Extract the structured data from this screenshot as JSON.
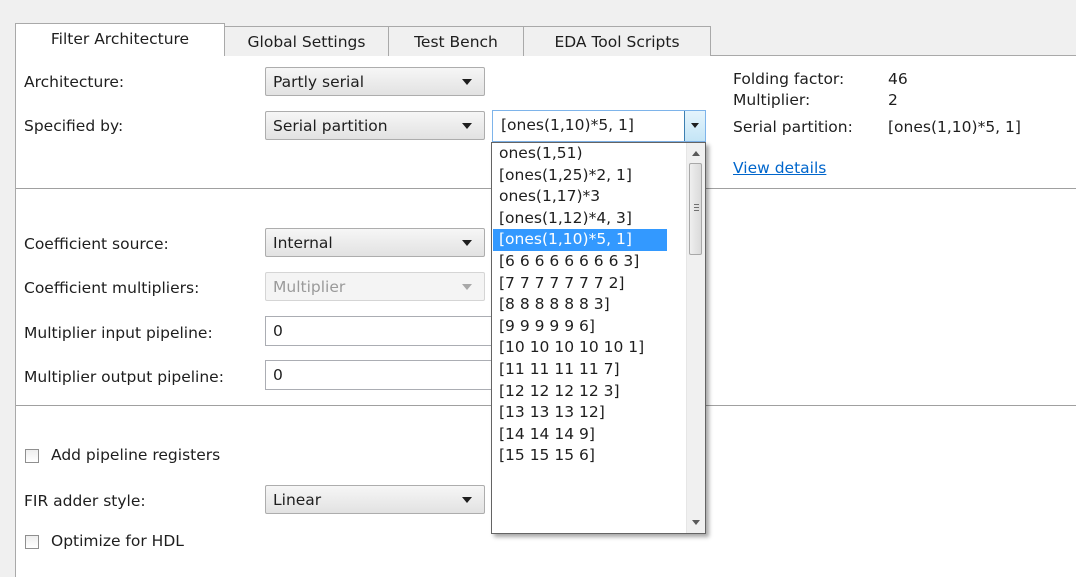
{
  "tabs": [
    {
      "label": "Filter Architecture",
      "active": true
    },
    {
      "label": "Global Settings",
      "active": false
    },
    {
      "label": "Test Bench",
      "active": false
    },
    {
      "label": "EDA Tool Scripts",
      "active": false
    }
  ],
  "architecture": {
    "label": "Architecture:",
    "value": "Partly serial"
  },
  "specified_by": {
    "label": "Specified by:",
    "value": "Serial partition"
  },
  "partition_combo": {
    "value": "[ones(1,10)*5, 1]",
    "options": [
      "ones(1,51)",
      "[ones(1,25)*2, 1]",
      "ones(1,17)*3",
      "[ones(1,12)*4, 3]",
      "[ones(1,10)*5, 1]",
      "[6 6 6 6 6 6 6 6 3]",
      "[7 7 7 7 7 7 7 2]",
      "[8 8 8 8 8 8 3]",
      "[9 9 9 9 9 6]",
      "[10 10 10 10 10 1]",
      "[11 11 11 11 7]",
      "[12 12 12 12 3]",
      "[13 13 13 12]",
      "[14 14 14 9]",
      "[15 15 15 6]"
    ],
    "selected_option": "[ones(1,10)*5, 1]"
  },
  "info": {
    "folding_label": "Folding factor:",
    "folding_value": "46",
    "multiplier_label": "Multiplier:",
    "multiplier_value": "2",
    "partition_label": "Serial partition:",
    "partition_value": "[ones(1,10)*5, 1]",
    "view_details": "View details"
  },
  "coefficient_source": {
    "label": "Coefficient source:",
    "value": "Internal"
  },
  "coefficient_multipliers": {
    "label": "Coefficient multipliers:",
    "value": "Multiplier"
  },
  "multiplier_input_pipeline": {
    "label": "Multiplier input pipeline:",
    "value": "0"
  },
  "multiplier_output_pipeline": {
    "label": "Multiplier output pipeline:",
    "value": "0"
  },
  "add_pipeline_registers": {
    "label": "Add pipeline registers",
    "checked": false
  },
  "fir_adder_style": {
    "label": "FIR adder style:",
    "value": "Linear"
  },
  "optimize_for_hdl": {
    "label": "Optimize for HDL",
    "checked": false
  },
  "colors": {
    "selection": "#3399ff",
    "link": "#0066cc",
    "background": "#f0f0f0",
    "panel": "#ffffff"
  }
}
